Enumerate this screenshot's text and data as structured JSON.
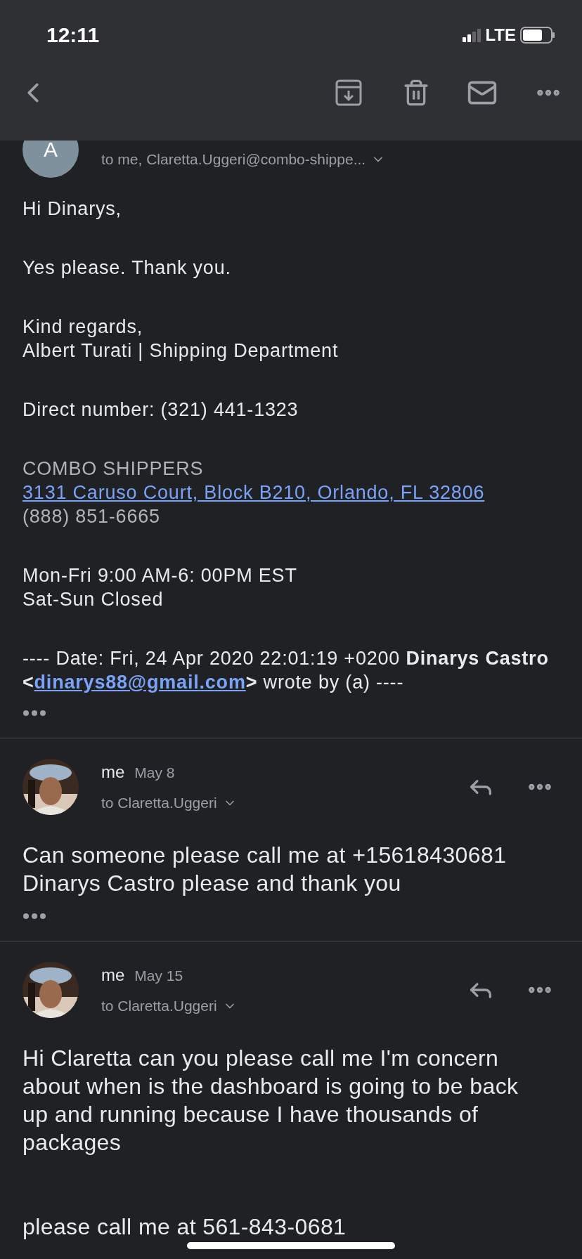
{
  "status_bar": {
    "time": "12:11",
    "network": "LTE"
  },
  "messages": [
    {
      "avatar": {
        "kind": "letter",
        "letter": "A"
      },
      "recipients": "to me, Claretta.Uggeri@combo-shippe...",
      "kind": "html",
      "body": [
        {
          "kind": "text",
          "text": "Hi Dinarys,"
        },
        {
          "kind": "text",
          "text": "Yes please. Thank you."
        },
        {
          "kind": "text",
          "text": "Kind regards,\nAlbert Turati | Shipping Department"
        },
        {
          "kind": "text",
          "text": "Direct number: (321) 441-1323"
        },
        {
          "kind": "company",
          "name": "COMBO SHIPPERS",
          "address": "3131 Caruso Court, Block B210, Orlando, FL 32806",
          "phone": "(888) 851-6665"
        },
        {
          "kind": "text",
          "text": "Mon-Fri 9:00 AM-6: 00PM EST\nSat-Sun Closed"
        },
        {
          "kind": "quote",
          "before": "---- Date: Fri, 24 Apr 2020 22:01:19 +0200 **Dinarys Castro <**",
          "link": "dinarys88@gmail.com",
          "after": "**>** wrote by (a) ----"
        }
      ]
    },
    {
      "avatar": {
        "kind": "picture"
      },
      "sender": "me",
      "date": "May 8",
      "recipients": "to Claretta.Uggeri",
      "kind": "plain",
      "body": [
        {
          "kind": "text",
          "text": "Can someone please call me at +15618430681\nDinarys Castro please and thank you"
        }
      ]
    },
    {
      "avatar": {
        "kind": "picture"
      },
      "sender": "me",
      "date": "May 15",
      "recipients": "to Claretta.Uggeri",
      "kind": "plain",
      "body": [
        {
          "kind": "text",
          "text": "Hi Claretta can you please call me I'm concern about when is the dashboard is going to be back up and running because I have thousands of packages"
        },
        {
          "kind": "text",
          "text": "please call me at 561-843-0681"
        }
      ]
    }
  ]
}
